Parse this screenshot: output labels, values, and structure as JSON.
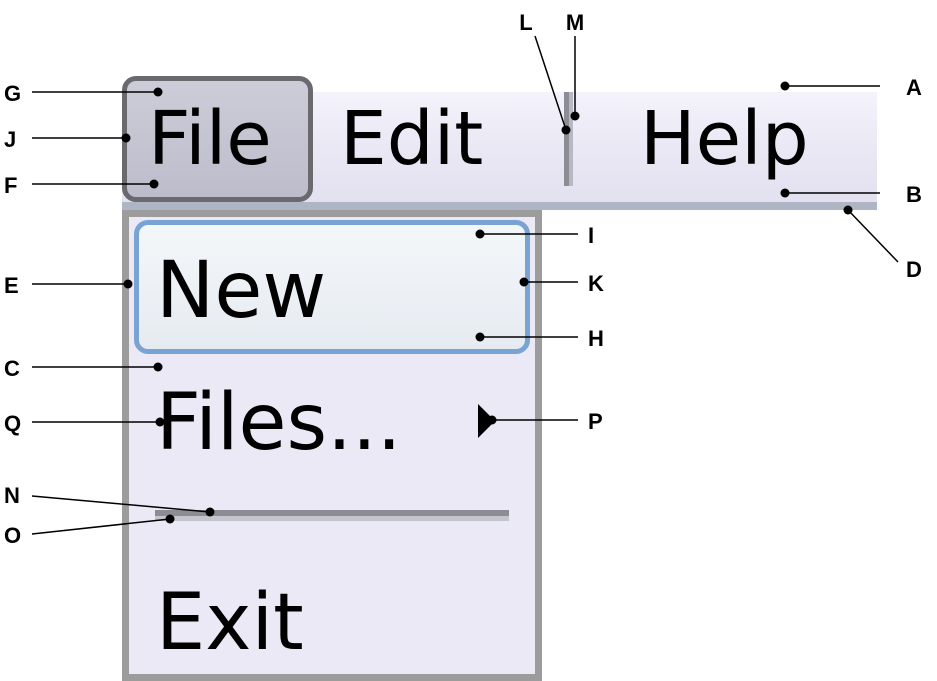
{
  "menubar": {
    "items": [
      {
        "label": "File",
        "state": "pressed"
      },
      {
        "label": "Edit",
        "state": "normal"
      },
      {
        "label": "Help",
        "state": "normal"
      }
    ]
  },
  "dropdown": {
    "items": [
      {
        "label": "New",
        "state": "hover"
      },
      {
        "label": "Files...",
        "has_submenu": true
      },
      {
        "label": "Exit"
      }
    ]
  },
  "callouts": [
    "A",
    "B",
    "C",
    "D",
    "E",
    "F",
    "G",
    "H",
    "I",
    "J",
    "K",
    "L",
    "M",
    "N",
    "O",
    "P",
    "Q"
  ],
  "colors": {
    "menubar_bg": "#ebe9f5",
    "pressed_item_border": "#6a6a6e",
    "pressed_item_bg": "#c4c4d2",
    "hover_item_border": "#78a3d3",
    "dropdown_border": "#9c9c9c",
    "separator": "#8c8c94"
  }
}
